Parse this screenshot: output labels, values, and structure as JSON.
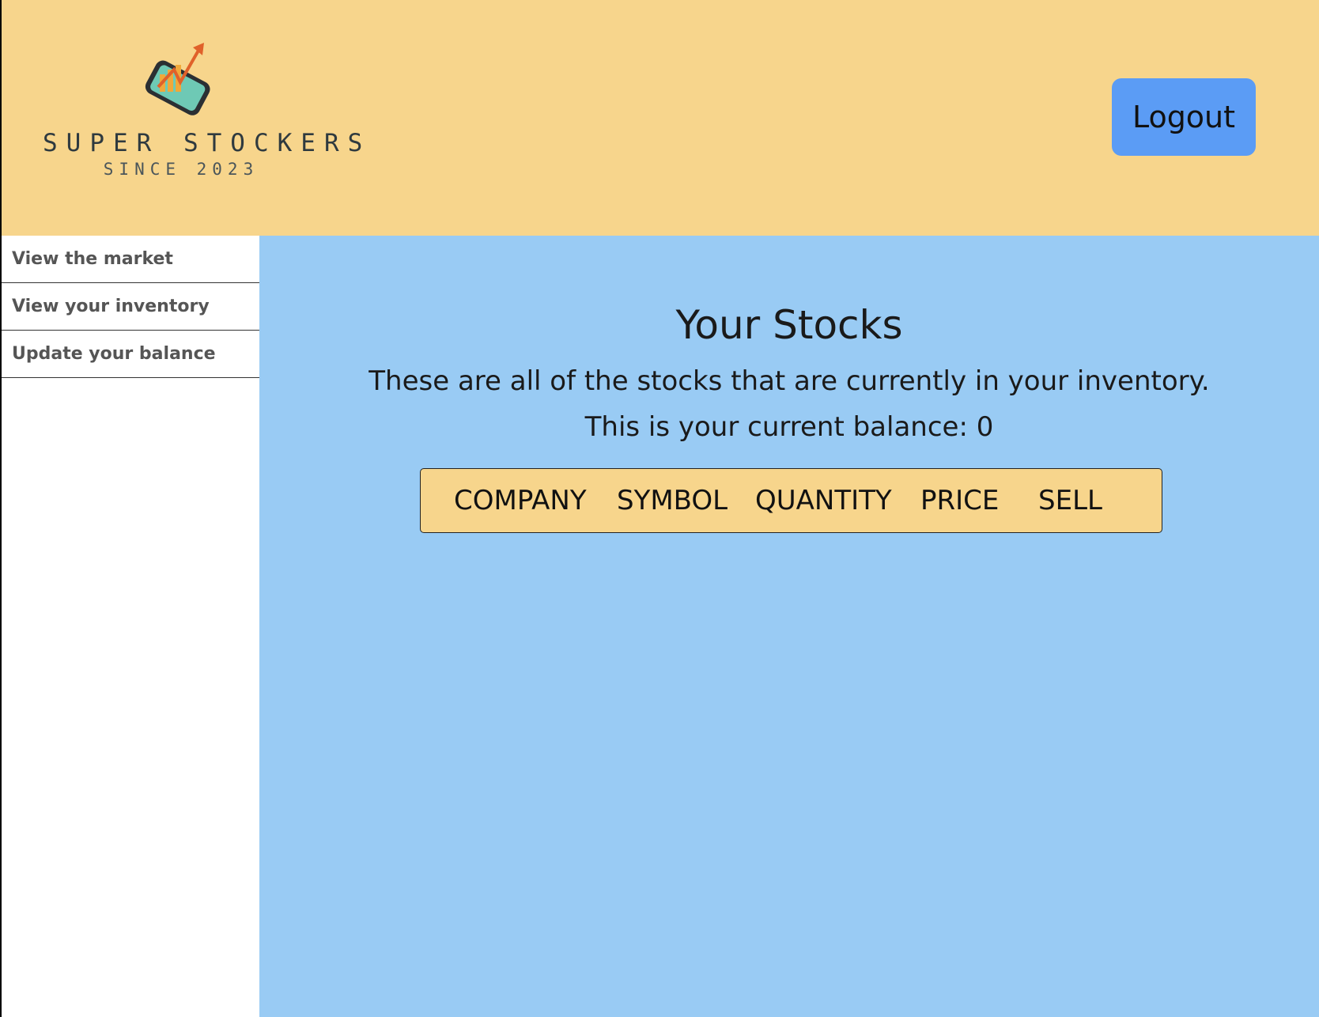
{
  "header": {
    "logo": {
      "title": "SUPER STOCKERS",
      "subtitle": "SINCE 2023",
      "icon": "phone-chart-arrow-icon"
    },
    "logout_label": "Logout"
  },
  "sidebar": {
    "items": [
      {
        "label": "View the market"
      },
      {
        "label": "View your inventory"
      },
      {
        "label": "Update your balance"
      }
    ]
  },
  "main": {
    "title": "Your Stocks",
    "description": "These are all of the stocks that are currently in your inventory.",
    "balance_text": "This is your current balance: 0",
    "table": {
      "columns": [
        "COMPANY",
        "SYMBOL",
        "QUANTITY",
        "PRICE",
        "SELL"
      ],
      "rows": []
    }
  },
  "colors": {
    "header_bg": "#f7d58c",
    "main_bg": "#99cbf4",
    "logout_bg": "#5b9cf5",
    "table_header_bg": "#f7d58c"
  }
}
